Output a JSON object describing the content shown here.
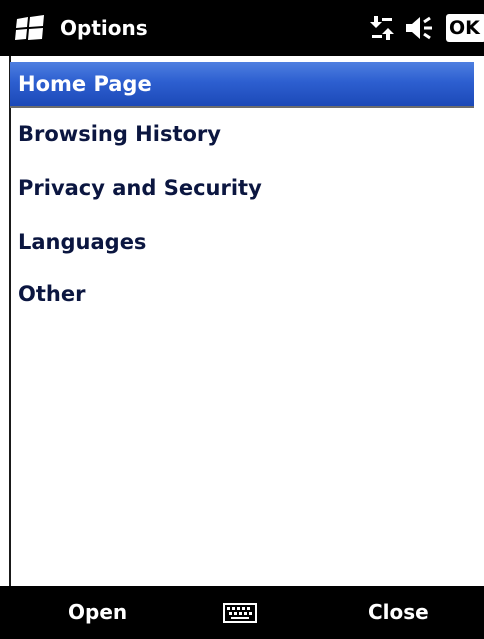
{
  "titlebar": {
    "title": "Options",
    "logo_icon": "windows-flag-icon",
    "connectivity_icon": "data-connection-icon",
    "volume_icon": "speaker-icon",
    "ok_label": "OK"
  },
  "menu": {
    "items": [
      {
        "label": "Home Page",
        "selected": true
      },
      {
        "label": "Browsing History",
        "selected": false
      },
      {
        "label": "Privacy and Security",
        "selected": false
      },
      {
        "label": "Languages",
        "selected": false
      },
      {
        "label": "Other",
        "selected": false
      }
    ]
  },
  "softkeys": {
    "left_label": "Open",
    "right_label": "Close",
    "center_icon": "keyboard-icon"
  },
  "colors": {
    "selection": "#2d5fd0",
    "item_text": "#0b1640",
    "bar_background": "#000000"
  }
}
